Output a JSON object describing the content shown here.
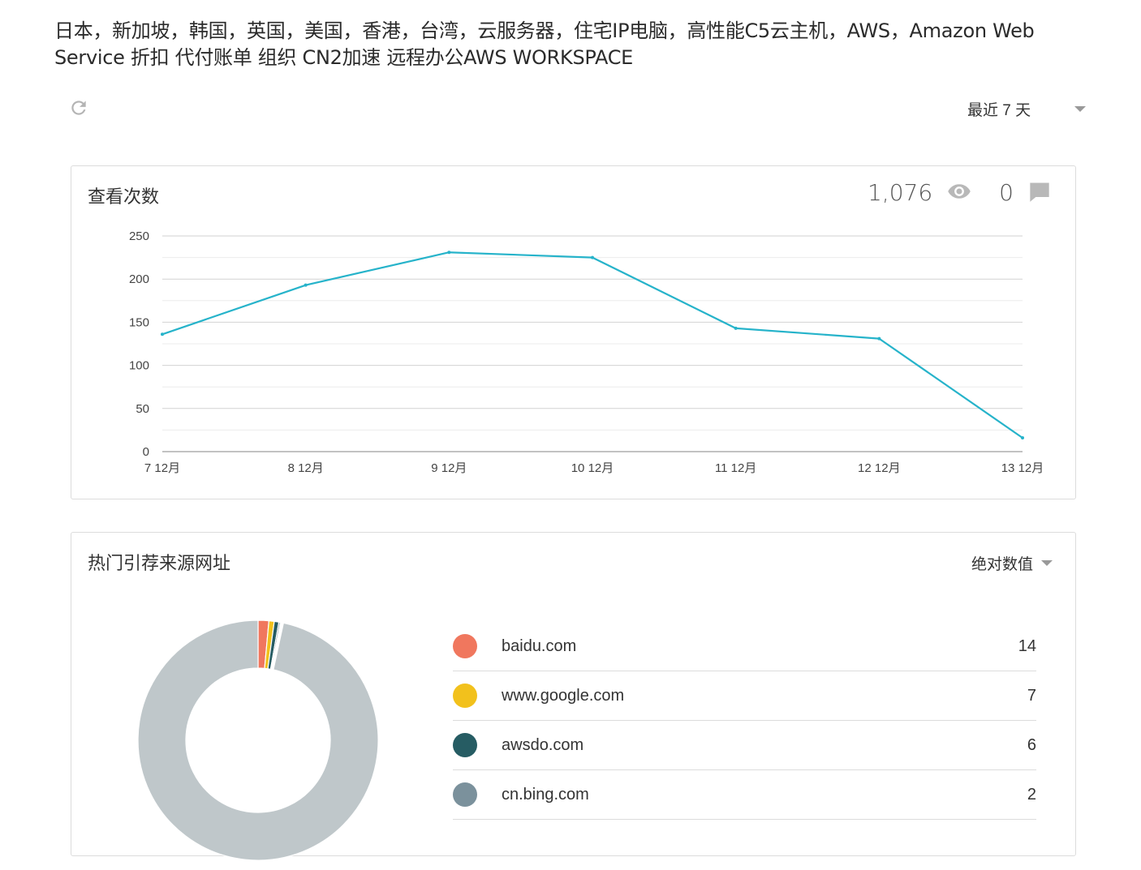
{
  "site": {
    "title": "日本，新加坡，韩国，英国，美国，香港，台湾，云服务器，住宅IP电脑，高性能C5云主机，AWS，Amazon Web Service 折扣 代付账单 组织 CN2加速 远程办公AWS WORKSPACE"
  },
  "toolbar": {
    "refresh_icon": "refresh-icon",
    "range_label": "最近 7 天"
  },
  "views_card": {
    "title": "查看次数",
    "views_total": "1,076",
    "views_icon": "eye-icon",
    "comments_total": "0",
    "comments_icon": "comment-icon"
  },
  "chart_data": {
    "type": "line",
    "title": "查看次数",
    "categories": [
      "7 12月",
      "8 12月",
      "9 12月",
      "10 12月",
      "11 12月",
      "12 12月",
      "13 12月"
    ],
    "series": [
      {
        "values": [
          136,
          193,
          231,
          225,
          143,
          131,
          16
        ]
      }
    ],
    "ylim": [
      0,
      250
    ],
    "yticks": [
      0,
      50,
      100,
      150,
      200,
      250
    ],
    "grid": true,
    "color": "#26b3ca"
  },
  "referrers_card": {
    "title": "热门引荐来源网址",
    "sort_label": "绝对数值",
    "items": [
      {
        "name": "baidu.com",
        "count": "14",
        "color": "#f0775e"
      },
      {
        "name": "www.google.com",
        "count": "7",
        "color": "#f2c11c"
      },
      {
        "name": "awsdo.com",
        "count": "6",
        "color": "#265c63"
      },
      {
        "name": "cn.bing.com",
        "count": "2",
        "color": "#7b919c"
      }
    ],
    "donut": {
      "segments": [
        {
          "value": 14,
          "color": "#f0775e"
        },
        {
          "value": 7,
          "color": "#f2c11c"
        },
        {
          "value": 6,
          "color": "#265c63"
        },
        {
          "value": 2,
          "color": "#7b919c"
        },
        {
          "value": 1,
          "color": "#dfe3e5"
        },
        {
          "value": 1,
          "color": "#dfe3e5"
        },
        {
          "value": 1,
          "color": "#dfe3e5"
        },
        {
          "value": 1,
          "color": "#dfe3e5"
        },
        {
          "value": 939,
          "color": "#bfc7ca"
        }
      ]
    }
  }
}
